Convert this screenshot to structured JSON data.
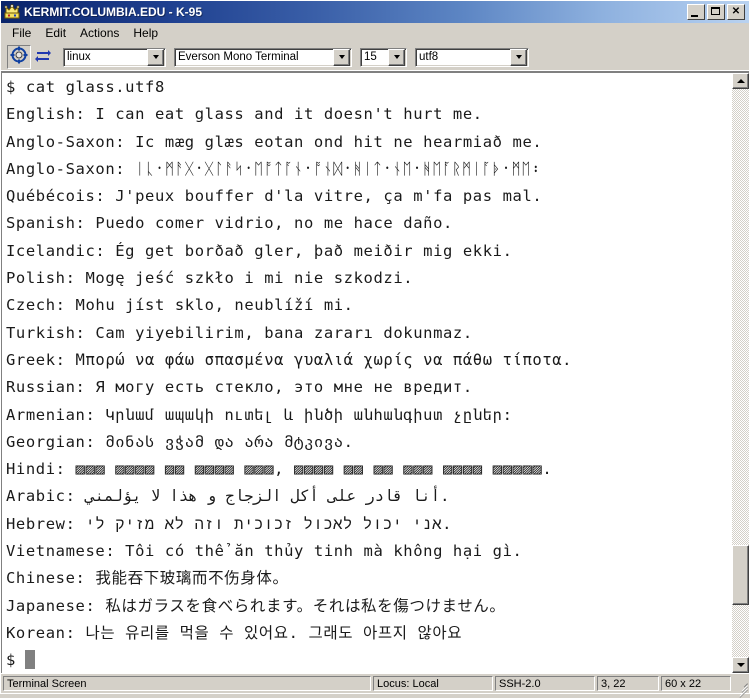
{
  "window": {
    "title": "KERMIT.COLUMBIA.EDU - K-95",
    "icon": "kermit-crown-icon",
    "controls": {
      "minimize": "minimize-button",
      "maximize": "maximize-button",
      "close": "close-button"
    }
  },
  "menu": {
    "items": [
      {
        "label": "File"
      },
      {
        "label": "Edit"
      },
      {
        "label": "Actions"
      },
      {
        "label": "Help"
      }
    ]
  },
  "toolbar": {
    "buttons": [
      {
        "name": "connect-icon",
        "title": "Connect"
      },
      {
        "name": "transfer-icon",
        "title": "Transfer"
      }
    ],
    "combos": [
      {
        "name": "terminal-type-combo",
        "value": "linux"
      },
      {
        "name": "font-combo",
        "value": "Everson Mono Terminal"
      },
      {
        "name": "font-size-combo",
        "value": "15"
      },
      {
        "name": "encoding-combo",
        "value": "utf8"
      }
    ]
  },
  "terminal": {
    "lines": [
      "$ cat glass.utf8",
      "English: I can eat glass and it doesn't hurt me.",
      "Anglo-Saxon: Ic mæg glæs eotan ond hit ne hearmiað me.",
      "Anglo-Saxon: ᛁᚳ᛫ᛗᚨᚷ᛫ᚷᛚᚨᛋ᛫ᛖᚩᛏᚪᚾ᛫ᚩᚾᛞ᛫ᚻᛁᛏ᛫ᚾᛖ᛫ᚻᛖᚪᚱᛗᛁᚪᚧ᛫ᛗᛖ᛬",
      "Québécois: J'peux bouffer d'la vitre, ça m'fa pas mal.",
      "Spanish: Puedo comer vidrio, no me hace daño.",
      "Icelandic: Ég get borðað gler, það meiðir mig ekki.",
      "Polish: Mogę jeść szkło i mi nie szkodzi.",
      "Czech: Mohu jíst sklo, neublíží mi.",
      "Turkish: Cam yiyebilirim, bana zararı dokunmaz.",
      "Greek: Μπορώ να φάω σπασμένα γυαλιά χωρίς να πάθω τίποτα.",
      "Russian: Я могу есть стекло, это мне не вредит.",
      "Armenian: Կրնամ ապակի ուտել և ինծի անհանգիստ չըներ:",
      "Georgian: მინას ვჭამ და არა მტკივა.",
      "Hindi: ▨▨▨ ▨▨▨▨ ▨▨ ▨▨▨▨ ▨▨▨, ▨▨▨▨ ▨▨ ▨▨ ▨▨▨ ▨▨▨▨ ▨▨▨▨▨.",
      "Arabic: أنا قادر على أكل الزجاج و هذا لا يؤلمني.",
      "Hebrew: אני יכול לאכול זכוכית וזה לא מזיק לי.",
      "Vietnamese: Tôi có thể ăn thủy tinh mà không hại gì.",
      "Chinese: 我能吞下玻璃而不伤身体。",
      "Japanese: 私はガラスを食べられます。それは私を傷つけません。",
      "Korean: 나는 유리를 먹을 수 있어요. 그래도 아프지 않아요",
      "$"
    ],
    "prompt_symbol": "$",
    "cursor_visible": true,
    "background_color": "#ffffff",
    "text_color": "#1a1a1a",
    "cursor_color": "#808080"
  },
  "scrollbar": {
    "up_arrow": "scroll-up-arrow",
    "down_arrow": "scroll-down-arrow",
    "thumb": "scroll-thumb"
  },
  "statusbar": {
    "screen_mode": "Terminal Screen",
    "locus": "Locus: Local",
    "protocol": "SSH-2.0",
    "position": "3, 22",
    "dimensions": "60 x 22"
  },
  "colors": {
    "title_start": "#0a246a",
    "title_end": "#b9d2f0",
    "chrome": "#d4d0c8",
    "terminal_bg": "#ffffff"
  }
}
